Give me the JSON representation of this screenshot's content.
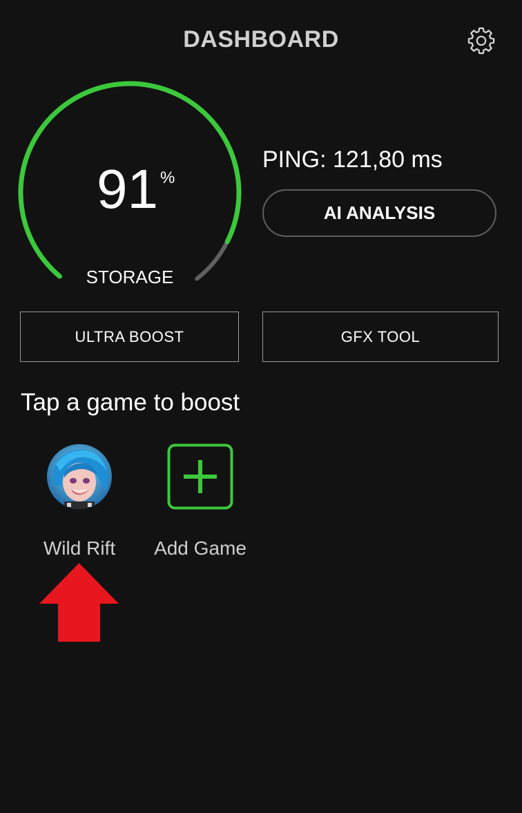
{
  "header": {
    "title": "DASHBOARD",
    "settings_icon": "gear-icon"
  },
  "storage": {
    "value": 91,
    "value_text": "91",
    "unit": "%",
    "label": "STORAGE",
    "progress": 0.91
  },
  "ping": {
    "text": "PING: 121,80 ms"
  },
  "buttons": {
    "ai_analysis": "AI ANALYSIS",
    "ultra_boost": "ULTRA BOOST",
    "gfx_tool": "GFX TOOL"
  },
  "games": {
    "heading": "Tap a game to boost",
    "items": [
      {
        "label": "Wild Rift",
        "icon": "game-avatar-icon"
      },
      {
        "label": "Add Game",
        "icon": "plus-icon"
      }
    ]
  },
  "annotation": {
    "icon": "arrow-up-icon"
  },
  "colors": {
    "background": "#121212",
    "accent_green": "#3cc83c",
    "track_gray": "#606060",
    "arrow_red": "#e8161e"
  }
}
